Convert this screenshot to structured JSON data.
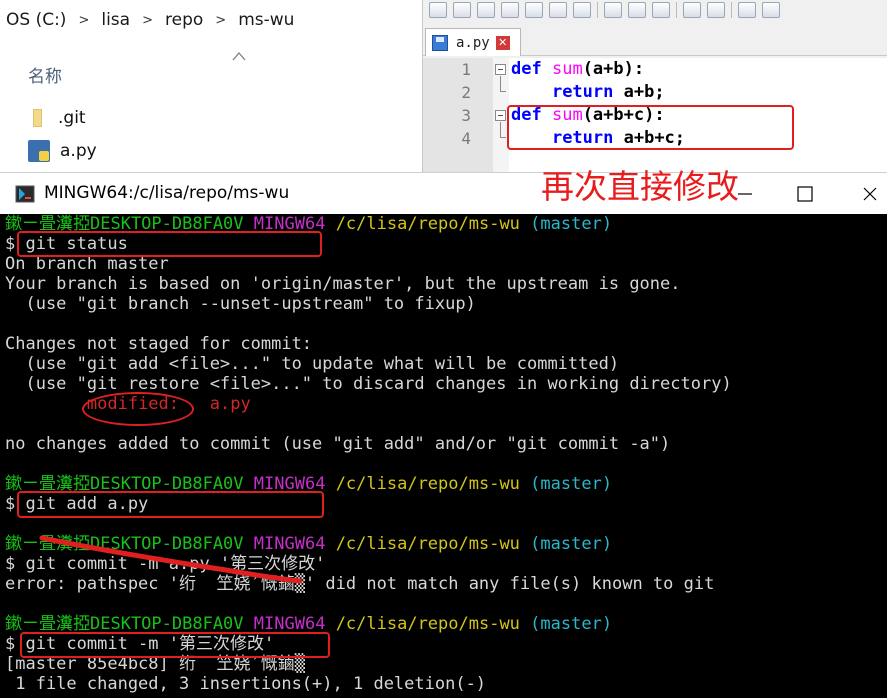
{
  "explorer": {
    "breadcrumbs": [
      "OS (C:)",
      "lisa",
      "repo",
      "ms-wu"
    ],
    "column_header": "名称",
    "files": [
      {
        "name": ".git",
        "icon": "folder-icon"
      },
      {
        "name": "a.py",
        "icon": "python-file-icon"
      }
    ]
  },
  "notepad": {
    "tab_label": "a.py",
    "code_lines": [
      {
        "num": "1",
        "kw": "def",
        "fn": "sum",
        "rest": "(a+b):"
      },
      {
        "num": "2",
        "indent": "    ",
        "kw": "return",
        "rest": " a+b;"
      },
      {
        "num": "3",
        "kw": "def",
        "fn": "sum",
        "rest": "(a+b+c):"
      },
      {
        "num": "4",
        "indent": "    ",
        "kw": "return",
        "rest": " a+b+c;"
      }
    ],
    "annotation": "再次直接修改"
  },
  "mingw": {
    "title": "MINGW64:/c/lisa/repo/ms-wu",
    "prompt": {
      "user_host": "鏉ㄧ畳瀵掗DESKTOP-DB8FA0V",
      "env": "MINGW64",
      "path": "/c/lisa/repo/ms-wu",
      "branch": "(master)"
    },
    "lines": {
      "cmd1": "$ git status",
      "l_on_branch": "On branch master",
      "l_upstream": "Your branch is based on 'origin/master', but the upstream is gone.",
      "l_use_unset": "  (use \"git branch --unset-upstream\" to fixup)",
      "l_changes": "Changes not staged for commit:",
      "l_use_add": "  (use \"git add <file>...\" to update what will be committed)",
      "l_use_restore": "  (use \"git restore <file>...\" to discard changes in working directory)",
      "l_modified_label": "modified:",
      "l_modified_file": "a.py",
      "l_no_changes": "no changes added to commit (use \"git add\" and/or \"git commit -a\")",
      "cmd2": "$ git add a.py",
      "cmd3": "$ git commit -m a.py '第三次修改'",
      "l_error": "error: pathspec '绗  笁娆′慨鏀▒' did not match any file(s) known to git",
      "cmd4": "$ git commit -m '第三次修改'",
      "l_master": "[master 85e4bc8] 绗  笁娆′慨鏀▒",
      "l_summary": " 1 file changed, 3 insertions(+), 1 deletion(-)"
    }
  },
  "colors": {
    "annotation_red": "#e02020",
    "prompt_green": "#17c217",
    "prompt_magenta": "#c52fc8",
    "prompt_yellow": "#d1c41a",
    "prompt_cyan": "#2ab7c9",
    "keyword_blue": "#0000ff",
    "function_magenta": "#ff00ff"
  }
}
